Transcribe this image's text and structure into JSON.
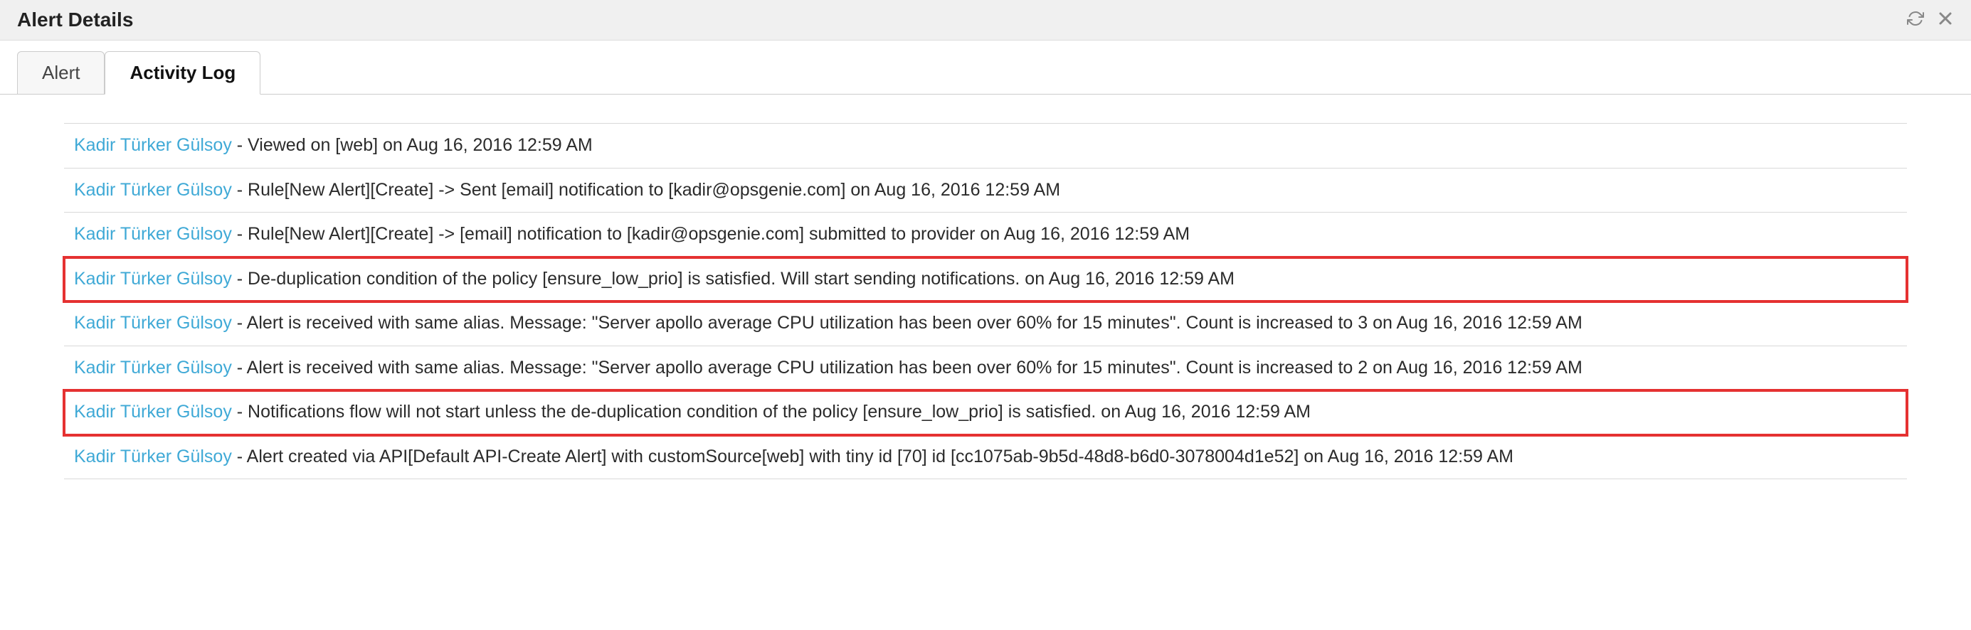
{
  "header": {
    "title": "Alert Details"
  },
  "tabs": {
    "alert": "Alert",
    "activity_log": "Activity Log"
  },
  "log": {
    "rows": [
      {
        "user": "Kadir Türker Gülsoy",
        "text": " - Viewed on [web] on Aug 16, 2016 12:59 AM",
        "hl": false
      },
      {
        "user": "Kadir Türker Gülsoy",
        "text": " - Rule[New Alert][Create] -> Sent [email] notification to [kadir@opsgenie.com] on Aug 16, 2016 12:59 AM",
        "hl": false
      },
      {
        "user": "Kadir Türker Gülsoy",
        "text": " - Rule[New Alert][Create] -> [email] notification to [kadir@opsgenie.com] submitted to provider on Aug 16, 2016 12:59 AM",
        "hl": false
      },
      {
        "user": "Kadir Türker Gülsoy",
        "text": " - De-duplication condition of the policy [ensure_low_prio] is satisfied. Will start sending notifications. on Aug 16, 2016 12:59 AM",
        "hl": true
      },
      {
        "user": "Kadir Türker Gülsoy",
        "text": " - Alert is received with same alias. Message: \"Server apollo average CPU utilization has been over 60% for 15 minutes\". Count is increased to 3 on Aug 16, 2016 12:59 AM",
        "hl": false
      },
      {
        "user": "Kadir Türker Gülsoy",
        "text": " - Alert is received with same alias. Message: \"Server apollo average CPU utilization has been over 60% for 15 minutes\". Count is increased to 2 on Aug 16, 2016 12:59 AM",
        "hl": false
      },
      {
        "user": "Kadir Türker Gülsoy",
        "text": " - Notifications flow will not start unless the de-duplication condition of the policy [ensure_low_prio] is satisfied. on Aug 16, 2016 12:59 AM",
        "hl": true
      },
      {
        "user": "Kadir Türker Gülsoy",
        "text": " - Alert created via API[Default API-Create Alert] with customSource[web] with tiny id [70] id [cc1075ab-9b5d-48d8-b6d0-3078004d1e52] on Aug 16, 2016 12:59 AM",
        "hl": false
      }
    ]
  }
}
